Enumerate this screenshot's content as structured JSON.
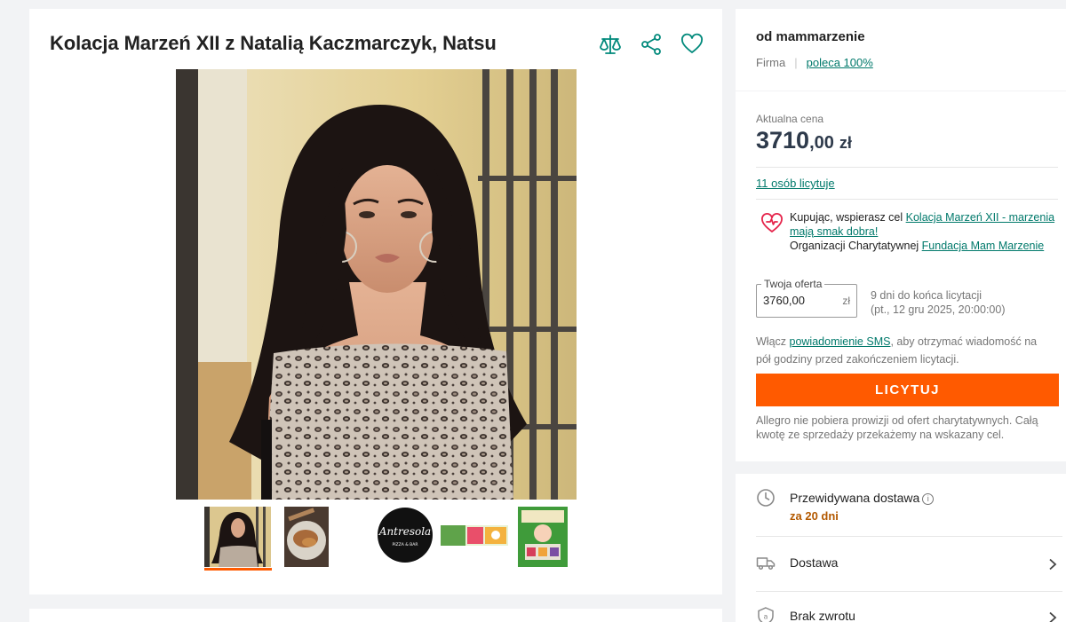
{
  "offer": {
    "title": "Kolacja Marzeń XII z Natalią Kaczmarczyk, Natsu",
    "actions": [
      "compare-icon",
      "share-icon",
      "heart-icon"
    ]
  },
  "gallery": {
    "main_image": "portrait of woman with long dark hair in leopard print top",
    "thumbnails": [
      "portrait thumbnail",
      "dish thumbnail",
      "Antresola logo thumbnail",
      "banner thumbnail",
      "poster thumbnail"
    ],
    "logo_text": {
      "name": "Antresola",
      "subtitle": "PIZZA & BAR"
    }
  },
  "seller": {
    "name": "od mammarzenie",
    "type": "Firma",
    "rating": "poleca 100%"
  },
  "pricing": {
    "label": "Aktualna cena",
    "amount": "3710",
    "cents": ",00",
    "currency": "zł",
    "bidders": "11 osób licytuje"
  },
  "charity": {
    "text_before": "Kupując, wspierasz cel ",
    "goal": "Kolacja Marzeń XII - marzenia mają smak dobra!",
    "text_org": "Organizacji Charytatywnej ",
    "organization": "Fundacja Mam Marzenie"
  },
  "bid": {
    "legend": "Twoja oferta",
    "value": "3760,00",
    "currency": "zł",
    "time_left": "9 dni do końca licytacji",
    "end_date": "(pt., 12 gru 2025, 20:00:00)",
    "sms_before": "Włącz ",
    "sms_link": "powiadomienie SMS",
    "sms_after": ", aby otrzymać wiadomość na pół godziny przed zakończeniem licytacji.",
    "button": "LICYTUJ",
    "fee_note": "Allegro nie pobiera prowizji od ofert charytatywnych. Całą kwotę ze sprzedaży przekażemy na wskazany cel."
  },
  "delivery": {
    "estimated_label": "Przewidywana dostawa",
    "estimated_value": "za 20 dni",
    "shipping_label": "Dostawa",
    "returns_label": "Brak zwrotu"
  },
  "colors": {
    "accent": "#ff5a00",
    "link": "#00796b",
    "price": "#2e3a4b",
    "eta": "#b35900",
    "background": "#f2f3f5"
  }
}
